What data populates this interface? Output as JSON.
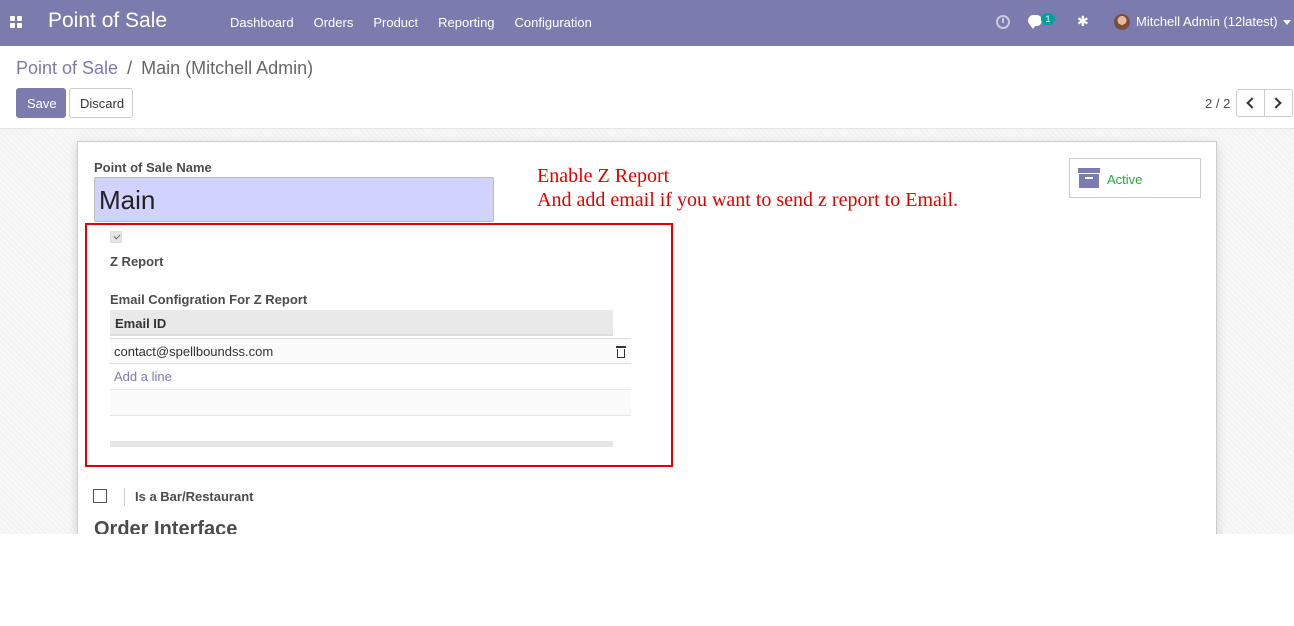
{
  "navbar": {
    "app_title": "Point of Sale",
    "menu": [
      "Dashboard",
      "Orders",
      "Product",
      "Reporting",
      "Configuration"
    ],
    "chat_badge": "1",
    "user_name": "Mitchell Admin (12latest)",
    "accent_color": "#7c7bad"
  },
  "breadcrumb": {
    "parent": "Point of Sale",
    "separator": "/",
    "current": "Main (Mitchell Admin)"
  },
  "buttons": {
    "save": "Save",
    "discard": "Discard"
  },
  "pager": {
    "value": "2 / 2"
  },
  "form": {
    "name_label": "Point of Sale Name",
    "name_value": "Main",
    "active_label": "Active",
    "z_report_label": "Z Report",
    "z_report_checked": true,
    "email_config_label": "Email Configration For Z Report",
    "email_table": {
      "header": "Email ID",
      "rows": [
        "contact@spellboundss.com"
      ],
      "add_line": "Add a line"
    },
    "bar_restaurant_label": "Is a Bar/Restaurant",
    "bar_restaurant_checked": false,
    "order_interface_title": "Order Interface"
  },
  "annotation": {
    "line1": "Enable Z Report",
    "line2": "And add email if you want to send z report to Email.",
    "color": "#e00000"
  }
}
